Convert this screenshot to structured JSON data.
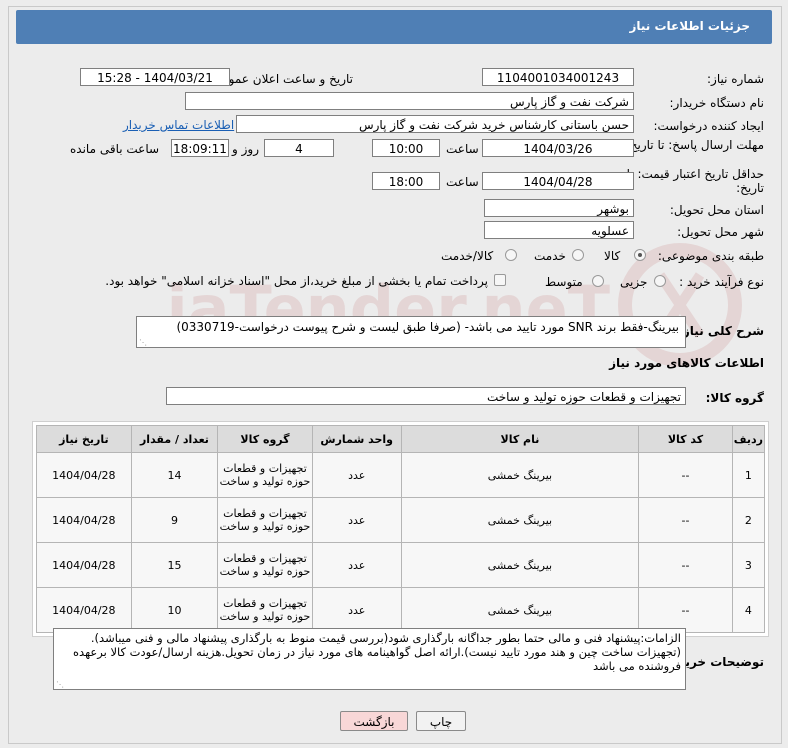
{
  "header": {
    "title": "جزئیات اطلاعات نیاز"
  },
  "form": {
    "need_number_label": "شماره نیاز:",
    "need_number": "1104001034001243",
    "announce_label": "تاریخ و ساعت اعلان عمومی:",
    "announce_value": "1404/03/21 - 15:28",
    "buyer_org_label": "نام دستگاه خریدار:",
    "buyer_org": "شرکت نفت و گاز پارس",
    "creator_label": "ایجاد کننده درخواست:",
    "creator": "حسن باستانی کارشناس خرید شرکت نفت و گاز پارس",
    "buyer_contact_link": "اطلاعات تماس خریدار",
    "deadline_label": "مهلت ارسال پاسخ: تا تاریخ:",
    "deadline_date": "1404/03/26",
    "time_label": "ساعت",
    "deadline_time": "10:00",
    "days_value": "4",
    "days_label": "روز و",
    "remaining_time": "18:09:11",
    "remaining_label": "ساعت باقی مانده",
    "validity_label": "حداقل تاریخ اعتبار قیمت: تا تاریخ:",
    "validity_date": "1404/04/28",
    "validity_time": "18:00",
    "province_label": "استان محل تحویل:",
    "province": "بوشهر",
    "city_label": "شهر محل تحویل:",
    "city": "عسلویه",
    "category_label": "طبقه بندی موضوعی:",
    "category_options": [
      "کالا",
      "خدمت",
      "کالا/خدمت"
    ],
    "category_selected": "کالا",
    "process_label": "نوع فرآیند خرید :",
    "process_options": [
      "جزیی",
      "متوسط"
    ],
    "payment_note": "پرداخت تمام یا بخشی از مبلغ خرید،از محل \"اسناد خزانه اسلامی\" خواهد بود."
  },
  "description": {
    "label": "شرح کلی نیاز:",
    "text": "بیرینگ-فقط برند SNR مورد تایید می باشد-  (صرفا طبق لیست و شرح پیوست درخواست-0330719)"
  },
  "goods": {
    "section_title": "اطلاعات کالاهای مورد نیاز",
    "group_label": "گروه کالا:",
    "group_value": "تجهیزات و قطعات حوزه تولید و ساخت",
    "columns": [
      "ردیف",
      "کد کالا",
      "نام کالا",
      "واحد شمارش",
      "گروه کالا",
      "تعداد / مقدار",
      "تاریخ نیاز"
    ],
    "rows": [
      {
        "row": "1",
        "code": "--",
        "name": "بیرینگ خمشی",
        "unit": "عدد",
        "group": "تجهیزات و قطعات حوزه تولید و ساخت",
        "qty": "14",
        "date": "1404/04/28"
      },
      {
        "row": "2",
        "code": "--",
        "name": "بیرینگ خمشی",
        "unit": "عدد",
        "group": "تجهیزات و قطعات حوزه تولید و ساخت",
        "qty": "9",
        "date": "1404/04/28"
      },
      {
        "row": "3",
        "code": "--",
        "name": "بیرینگ خمشی",
        "unit": "عدد",
        "group": "تجهیزات و قطعات حوزه تولید و ساخت",
        "qty": "15",
        "date": "1404/04/28"
      },
      {
        "row": "4",
        "code": "--",
        "name": "بیرینگ خمشی",
        "unit": "عدد",
        "group": "تجهیزات و قطعات حوزه تولید و ساخت",
        "qty": "10",
        "date": "1404/04/28"
      }
    ]
  },
  "notes": {
    "label": "توضیحات خریدار:",
    "text": "الزامات:پیشنهاد فنی و مالی حتما  بطور جداگانه بارگذاری شود(بررسی قیمت منوط به بارگذاری پیشنهاد مالی و فنی میباشد).(تجهیزات ساخت چین و هند مورد تایید نیست).ارائه اصل گواهینامه های مورد نیاز در زمان تحویل.هزینه ارسال/عودت کالا برعهده فروشنده می باشد"
  },
  "buttons": {
    "print": "چاپ",
    "back": "بازگشت"
  },
  "watermark": {
    "text": "AriaTender.neT"
  },
  "colors": {
    "header": "#4f7fb5",
    "back_button": "#f8d7d7",
    "print_button": "#f2f2f2"
  }
}
